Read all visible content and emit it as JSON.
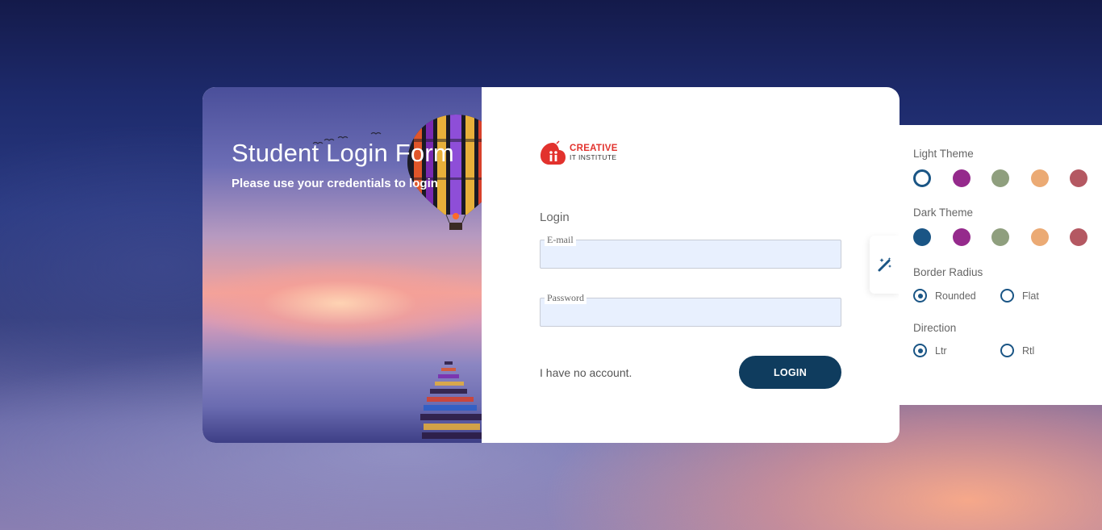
{
  "hero": {
    "title": "Student Login Form",
    "subtitle": "Please use your credentials to login"
  },
  "brand": {
    "line1": "CREATIVE",
    "line2": "IT INSTITUTE",
    "color": "#e2322d"
  },
  "form": {
    "heading": "Login",
    "email_label": "E-mail",
    "email_value": "",
    "password_label": "Password",
    "password_value": "",
    "no_account_link": "I have no account.",
    "login_button": "LOGIN",
    "button_color": "#0f3c5e"
  },
  "settings": {
    "toggle_icon": "magic-wand-icon",
    "light_theme": {
      "title": "Light Theme",
      "colors": [
        "#1a5585",
        "#952a8c",
        "#8f9f7e",
        "#ebaa74",
        "#b45862"
      ],
      "selected": 0
    },
    "dark_theme": {
      "title": "Dark Theme",
      "colors": [
        "#1a5585",
        "#952a8c",
        "#8f9f7e",
        "#ebaa74",
        "#b45862"
      ]
    },
    "border_radius": {
      "title": "Border Radius",
      "options": [
        {
          "label": "Rounded",
          "selected": true
        },
        {
          "label": "Flat",
          "selected": false
        }
      ]
    },
    "direction": {
      "title": "Direction",
      "options": [
        {
          "label": "Ltr",
          "selected": true
        },
        {
          "label": "Rtl",
          "selected": false
        }
      ]
    }
  }
}
